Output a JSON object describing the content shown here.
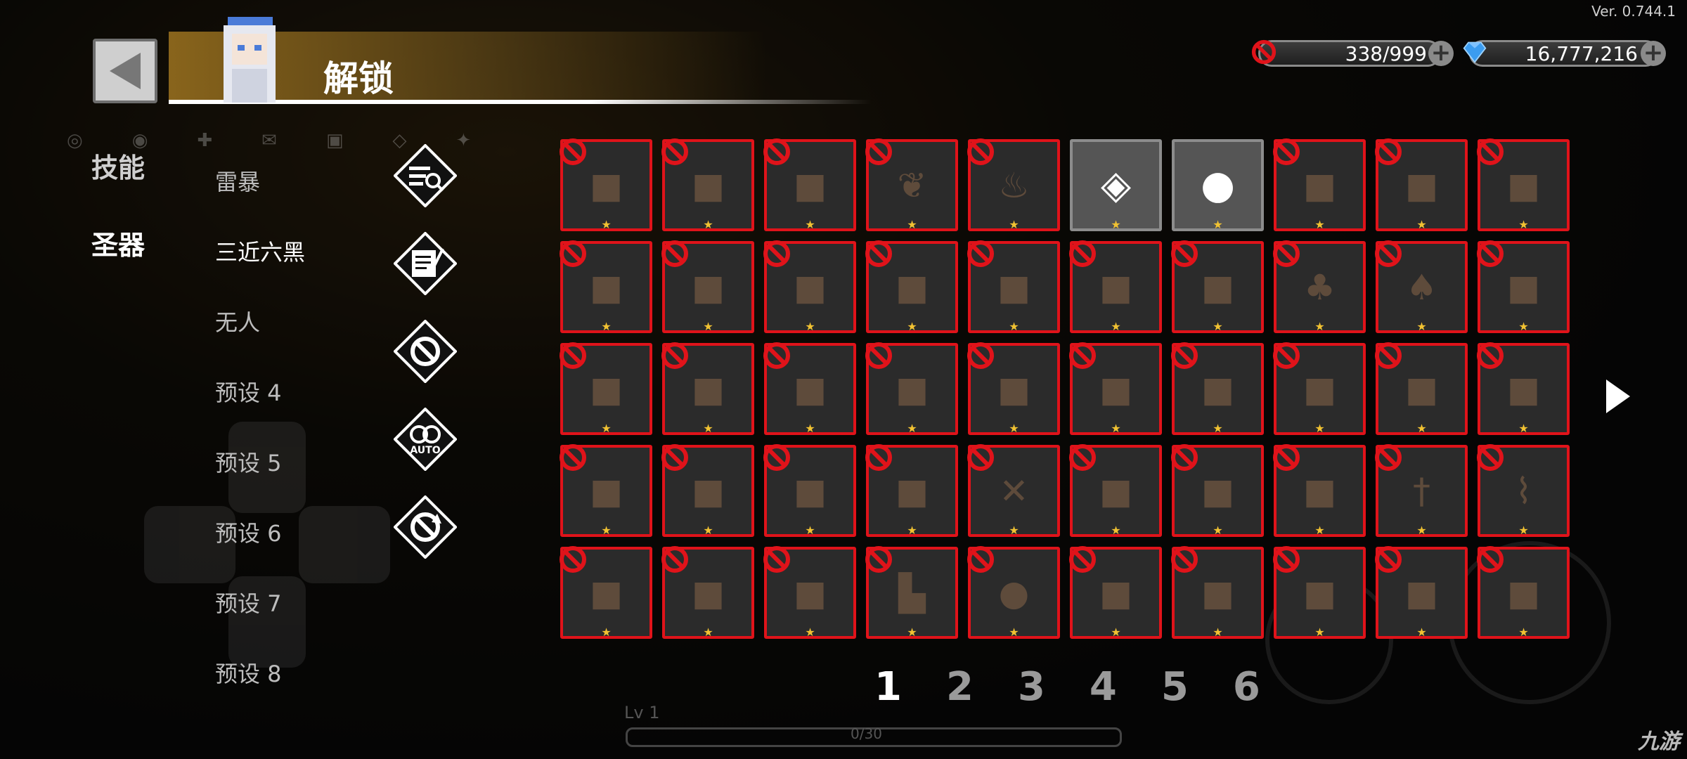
{
  "version": "Ver. 0.744.1",
  "header": {
    "title": "解锁",
    "back_icon": "back-arrow-icon"
  },
  "currency": {
    "keys": "338/999",
    "gems": "16,777,216"
  },
  "tabs": [
    "技能",
    "圣器"
  ],
  "active_tab": "圣器",
  "presets": [
    "雷暴",
    "三近六黑",
    "无人",
    "预设 4",
    "预设 5",
    "预设 6",
    "预设 7",
    "预设 8"
  ],
  "active_preset": "三近六黑",
  "tools": [
    "search-list-icon",
    "scroll-quill-icon",
    "ban-ring-icon",
    "auto-rings-icon",
    "refresh-ban-icon"
  ],
  "tool_auto_label": "AUTO",
  "items": [
    {
      "icon": "stone-tablet-icon",
      "unlocked": false
    },
    {
      "icon": "garlic-icon",
      "unlocked": false
    },
    {
      "icon": "fire-crystal-icon",
      "unlocked": false
    },
    {
      "icon": "feather-icon",
      "unlocked": false
    },
    {
      "icon": "potion-icon",
      "unlocked": false
    },
    {
      "icon": "fox-mask-icon",
      "unlocked": true
    },
    {
      "icon": "ghost-icon",
      "unlocked": true
    },
    {
      "icon": "scroll-icon",
      "unlocked": false
    },
    {
      "icon": "scroll-icon",
      "unlocked": false
    },
    {
      "icon": "meat-icon",
      "unlocked": false
    },
    {
      "icon": "chain-icon",
      "unlocked": false
    },
    {
      "icon": "demon-crown-icon",
      "unlocked": false
    },
    {
      "icon": "coal-icon",
      "unlocked": false
    },
    {
      "icon": "ice-shard-icon",
      "unlocked": false
    },
    {
      "icon": "amethyst-icon",
      "unlocked": false
    },
    {
      "icon": "rock-icon",
      "unlocked": false
    },
    {
      "icon": "blue-orb-icon",
      "unlocked": false
    },
    {
      "icon": "tree-icon",
      "unlocked": false
    },
    {
      "icon": "mushroom-icon",
      "unlocked": false
    },
    {
      "icon": "teal-coins-icon",
      "unlocked": false
    },
    {
      "icon": "red-scarf-icon",
      "unlocked": false
    },
    {
      "icon": "vase-icon",
      "unlocked": false
    },
    {
      "icon": "spoon-icon",
      "unlocked": false
    },
    {
      "icon": "pipe-icon",
      "unlocked": false
    },
    {
      "icon": "wood-log-icon",
      "unlocked": false
    },
    {
      "icon": "plank-icon",
      "unlocked": false
    },
    {
      "icon": "crystal-ball-icon",
      "unlocked": false
    },
    {
      "icon": "purple-lantern-icon",
      "unlocked": false
    },
    {
      "icon": "book-icon",
      "unlocked": false
    },
    {
      "icon": "crystal-block-icon",
      "unlocked": false
    },
    {
      "icon": "green-shell-icon",
      "unlocked": false
    },
    {
      "icon": "rifle-icon",
      "unlocked": false
    },
    {
      "icon": "paw-icon",
      "unlocked": false
    },
    {
      "icon": "staff-icon",
      "unlocked": false
    },
    {
      "icon": "crossed-swords-icon",
      "unlocked": false
    },
    {
      "icon": "leaf-icon",
      "unlocked": false
    },
    {
      "icon": "blue-book-icon",
      "unlocked": false
    },
    {
      "icon": "red-feather-icon",
      "unlocked": false
    },
    {
      "icon": "dagger-icon",
      "unlocked": false
    },
    {
      "icon": "knife-icon",
      "unlocked": false
    },
    {
      "icon": "purple-gem-icon",
      "unlocked": false
    },
    {
      "icon": "robot-icon",
      "unlocked": false
    },
    {
      "icon": "gold-bars-icon",
      "unlocked": false
    },
    {
      "icon": "boot-icon",
      "unlocked": false
    },
    {
      "icon": "gold-coin-icon",
      "unlocked": false
    },
    {
      "icon": "spider-icon",
      "unlocked": false
    },
    {
      "icon": "cookie-icon",
      "unlocked": false
    },
    {
      "icon": "frog-icon",
      "unlocked": false
    },
    {
      "icon": "slime-icon",
      "unlocked": false
    },
    {
      "icon": "red-helmet-icon",
      "unlocked": false
    }
  ],
  "pages": [
    "1",
    "2",
    "3",
    "4",
    "5",
    "6"
  ],
  "active_page": "1",
  "level": "Lv 1",
  "xp": "0/30",
  "watermark": "九游"
}
